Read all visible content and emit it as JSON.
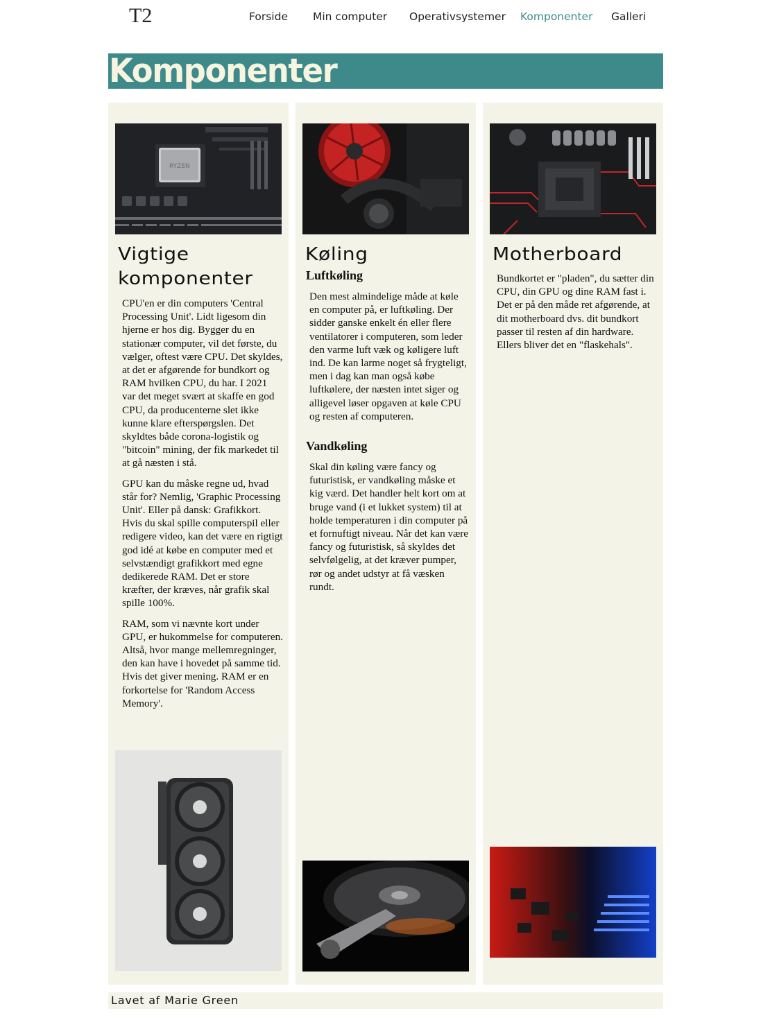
{
  "site": {
    "logo": "T2"
  },
  "nav": {
    "items": [
      {
        "label": "Forside",
        "active": false
      },
      {
        "label": "Min computer",
        "active": false
      },
      {
        "label": "Operativsystemer",
        "active": false
      },
      {
        "label": "Komponenter",
        "active": true
      },
      {
        "label": "Galleri",
        "active": false
      }
    ],
    "active_color": "#3e8a8a"
  },
  "banner": {
    "title": "Komponenter",
    "background": "#3e8a8a",
    "text_color": "#f7f5df"
  },
  "columns": [
    {
      "heading_line1": "Vigtige",
      "heading_line2": "komponenter",
      "paragraphs": [
        "CPU'en er din computers 'Central Processing Unit'. Lidt ligesom din hjerne er hos dig. Bygger du en stationær computer, vil det første, du vælger, oftest være CPU. Det skyldes, at det er afgørende for bundkort og RAM hvilken CPU, du har. I 2021 var det meget svært at skaffe en god CPU, da producenterne slet ikke kunne klare efterspørgslen. Det skyldtes både corona-logistik og \"bitcoin\" mining, der fik markedet til at gå næsten i stå.",
        "GPU kan du måske regne ud, hvad står for? Nemlig, 'Graphic Processing Unit'. Eller på dansk: Grafikkort. Hvis du skal spille computerspil eller redigere video, kan det være en rigtigt god idé at købe en computer med et selvstændigt grafikkort med egne dedikerede RAM. Det er store kræfter, der kræves, når grafik skal spille 100%.",
        "RAM, som vi nævnte kort under GPU, er hukommelse for computeren. Altså, hvor mange mellemregninger, den kan have i hovedet på samme tid. Hvis det giver mening. RAM er en forkortelse for 'Random Access Memory'."
      ]
    },
    {
      "heading": "Køling",
      "sub1": "Luftkøling",
      "text1": "Den mest almindelige måde at køle en computer på, er luftkøling. Der sidder ganske enkelt én eller flere ventilatorer i computeren, som leder den varme luft væk og køligere luft ind. De kan larme noget så frygteligt, men i dag kan man også købe luftkølere, der næsten intet siger og alligevel løser opgaven at køle CPU og resten af computeren.",
      "sub2": "Vandkøling",
      "text2": "Skal din køling være fancy og futuristisk, er vandkøling måske et kig værd. Det handler helt kort om at bruge vand (i et lukket system) til at holde temperaturen i din computer på et fornuftigt niveau. Når det kan være fancy og futuristisk, så skyldes det selvfølgelig, at det kræver pumper, rør og andet udstyr at få væsken rundt."
    },
    {
      "heading": "Motherboard",
      "text": "Bundkortet er \"pladen\", du sætter din CPU, din GPU og dine RAM fast i. Det er på den måde ret afgørende, at dit motherboard dvs. dit bundkort passer til resten af din hardware. Ellers bliver det en \"flaskehals\"."
    }
  ],
  "footer": {
    "text": "Lavet af Marie Green"
  },
  "images": {
    "cpu": "cpu-on-motherboard-photo",
    "cooler": "red-cpu-cooler-photo",
    "socket": "motherboard-socket-photo",
    "gpu": "graphics-card-photo",
    "hdd": "hard-drive-photo",
    "circuit": "red-blue-circuit-photo"
  },
  "colors": {
    "column_bg": "#f3f3e7",
    "accent": "#3e8a8a"
  }
}
